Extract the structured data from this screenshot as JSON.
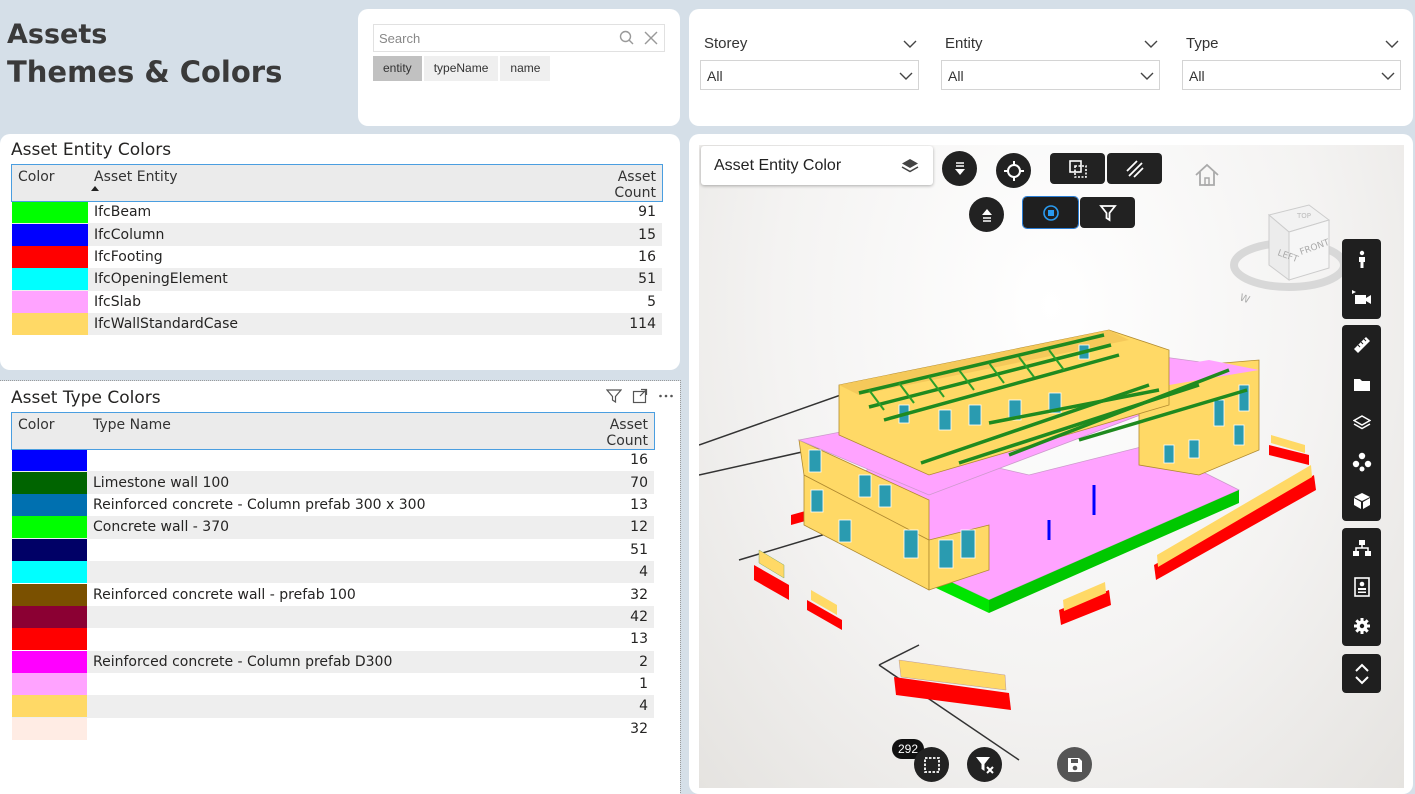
{
  "title": {
    "line1": "Assets",
    "line2": "Themes & Colors"
  },
  "search": {
    "placeholder": "Search",
    "chips": [
      "entity",
      "typeName",
      "name"
    ],
    "selected_chip": "entity"
  },
  "slicers": [
    {
      "label": "Storey",
      "value": "All"
    },
    {
      "label": "Entity",
      "value": "All"
    },
    {
      "label": "Type",
      "value": "All"
    }
  ],
  "entity_table": {
    "title": "Asset Entity Colors",
    "columns": [
      "Color",
      "Asset Entity",
      "Asset Count"
    ],
    "rows": [
      {
        "color": "#00ff00",
        "name": "IfcBeam",
        "count": "91"
      },
      {
        "color": "#0000ff",
        "name": "IfcColumn",
        "count": "15"
      },
      {
        "color": "#ff0000",
        "name": "IfcFooting",
        "count": "16"
      },
      {
        "color": "#00ffff",
        "name": "IfcOpeningElement",
        "count": "51"
      },
      {
        "color": "#ffa3ff",
        "name": "IfcSlab",
        "count": "5"
      },
      {
        "color": "#ffd966",
        "name": "IfcWallStandardCase",
        "count": "114"
      }
    ]
  },
  "type_table": {
    "title": "Asset Type Colors",
    "columns": [
      "Color",
      "Type Name",
      "Asset Count"
    ],
    "rows": [
      {
        "color": "#0000ff",
        "name": "",
        "count": "16"
      },
      {
        "color": "#006400",
        "name": "Limestone wall 100",
        "count": "70"
      },
      {
        "color": "#0070b0",
        "name": "Reinforced concrete - Column prefab 300 x 300",
        "count": "13"
      },
      {
        "color": "#00ff00",
        "name": "Concrete wall - 370",
        "count": "12"
      },
      {
        "color": "#000066",
        "name": "",
        "count": "51"
      },
      {
        "color": "#00ffff",
        "name": "",
        "count": "4"
      },
      {
        "color": "#7a5000",
        "name": "Reinforced concrete wall - prefab 100",
        "count": "32"
      },
      {
        "color": "#8b0033",
        "name": "",
        "count": "42"
      },
      {
        "color": "#ff0000",
        "name": "",
        "count": "13"
      },
      {
        "color": "#ff00ff",
        "name": "Reinforced concrete - Column prefab D300",
        "count": "2"
      },
      {
        "color": "#ffa3ff",
        "name": "",
        "count": "1"
      },
      {
        "color": "#ffd966",
        "name": "",
        "count": "4"
      },
      {
        "color": "#ffece4",
        "name": "",
        "count": "32"
      }
    ]
  },
  "viewer": {
    "layer_label": "Asset Entity Color",
    "selection_count": "292",
    "cube_labels": {
      "left": "LEFT",
      "front": "FRONT",
      "top": "TOP",
      "compass": "W"
    }
  }
}
